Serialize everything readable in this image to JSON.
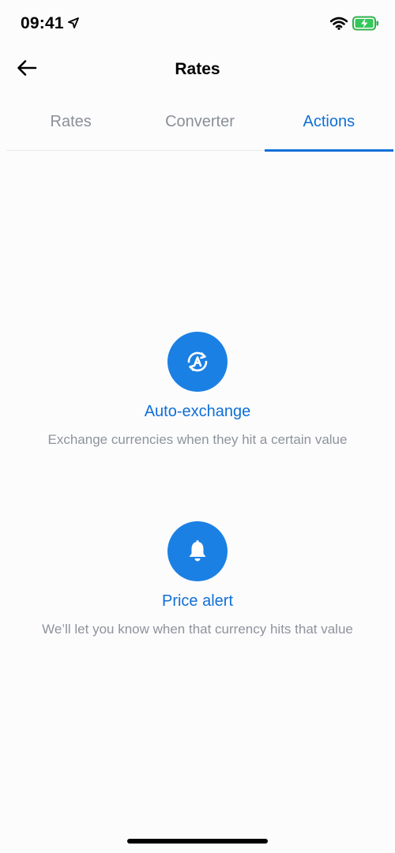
{
  "status_bar": {
    "time": "09:41",
    "icons": [
      "location-arrow-icon",
      "wifi-icon",
      "battery-charging-icon"
    ],
    "battery_color": "#34c759"
  },
  "nav": {
    "title": "Rates",
    "back_icon": "arrow-left-icon"
  },
  "tabs": [
    {
      "label": "Rates",
      "active": false
    },
    {
      "label": "Converter",
      "active": false
    },
    {
      "label": "Actions",
      "active": true
    }
  ],
  "actions": [
    {
      "icon": "auto-exchange-icon",
      "title": "Auto-exchange",
      "description": "Exchange currencies when they hit a certain value"
    },
    {
      "icon": "bell-icon",
      "title": "Price alert",
      "description": "We’ll let you know when that currency hits that value"
    }
  ],
  "colors": {
    "accent": "#0f6fd6",
    "icon_circle": "#1b80e4",
    "muted_text": "#8e939b"
  }
}
